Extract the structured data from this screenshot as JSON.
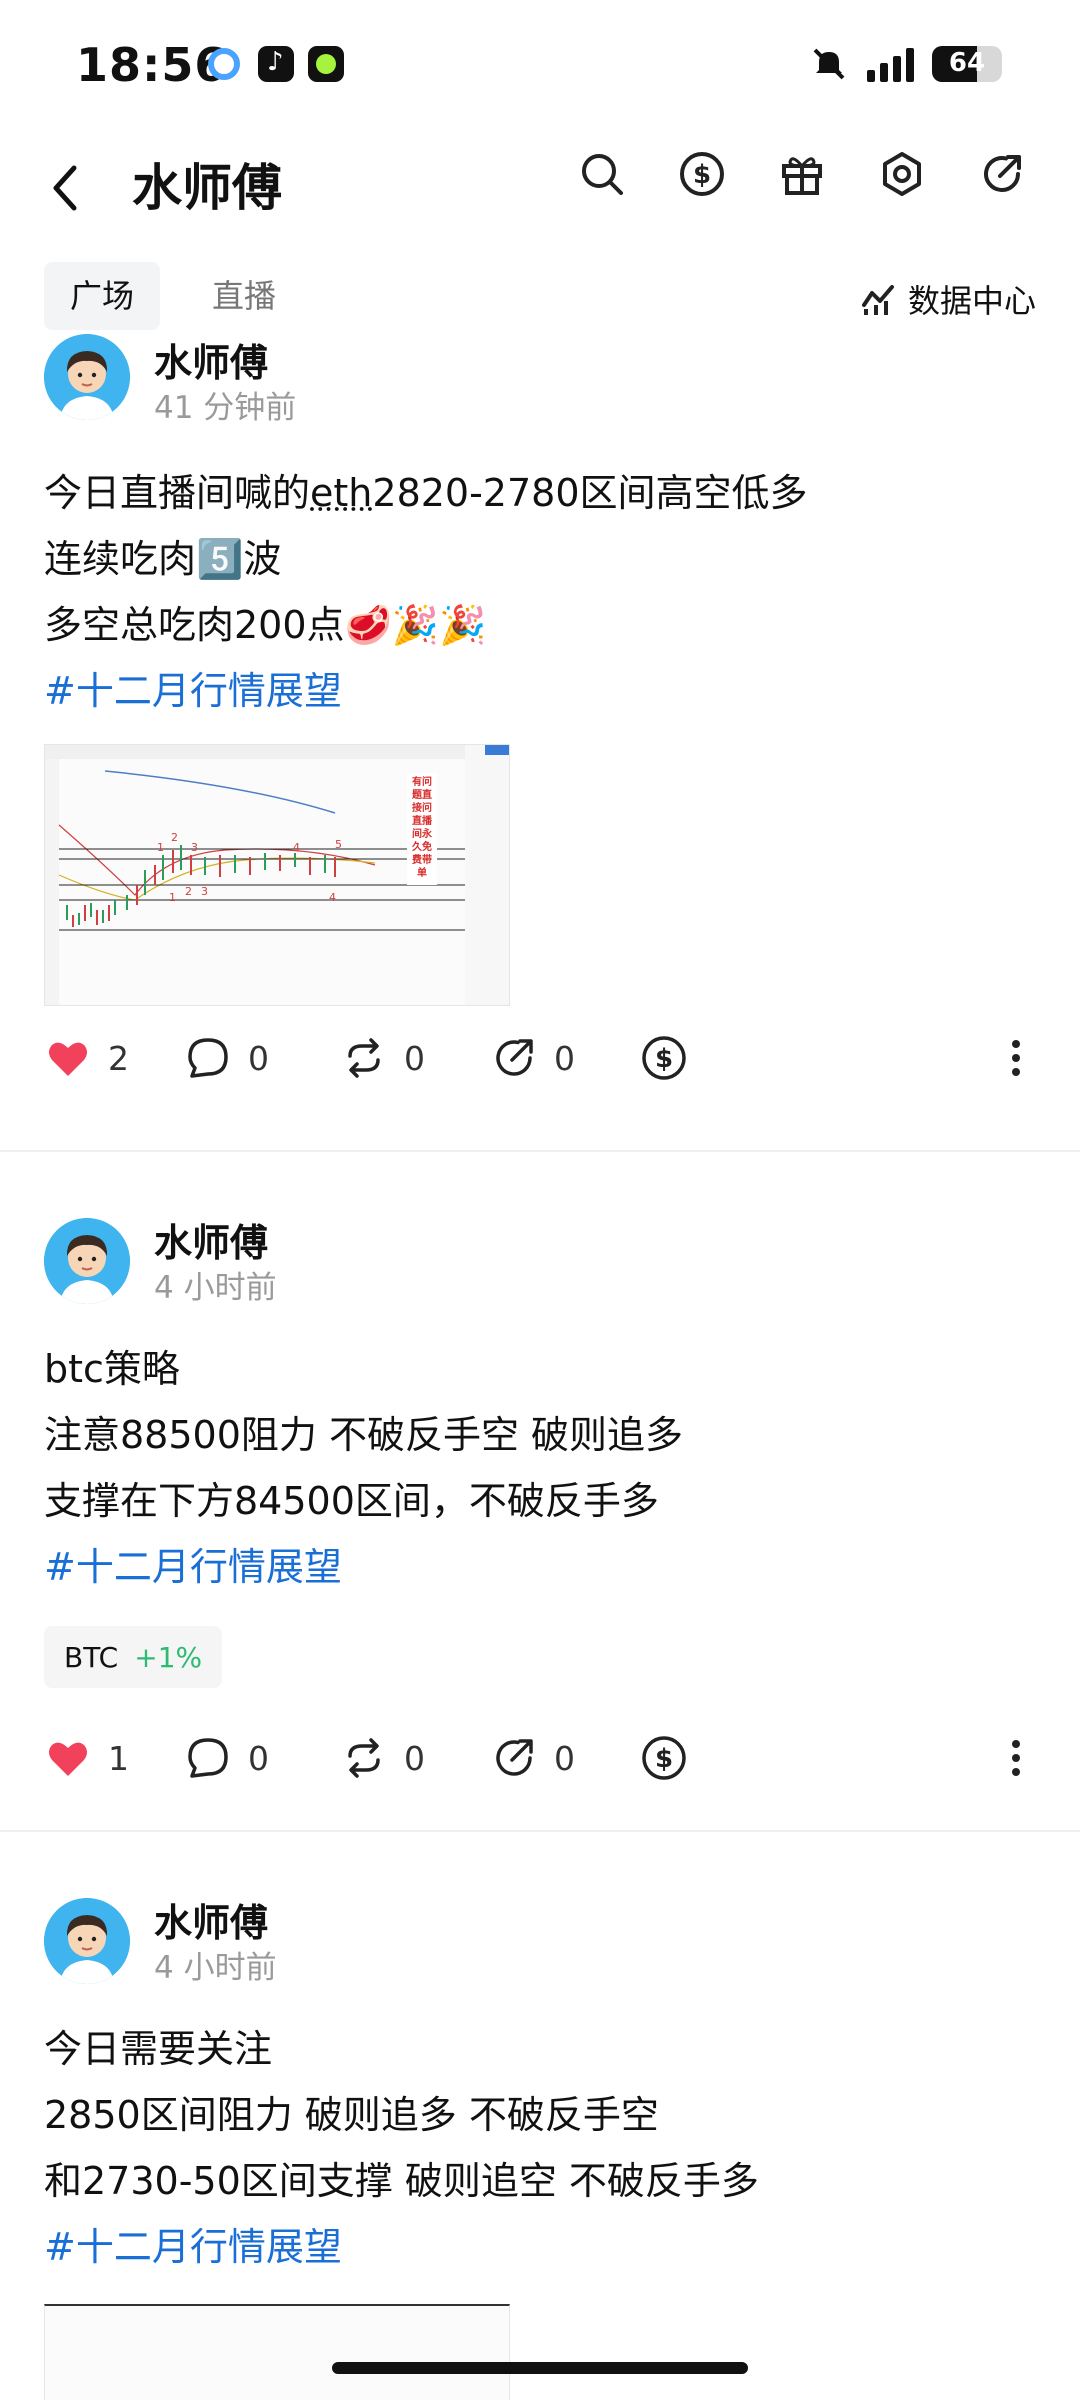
{
  "status_bar": {
    "time": "18:56",
    "battery": "64",
    "battery_level": 0.64
  },
  "nav": {
    "title": "水师傅",
    "back_icon": "chevron-left-icon",
    "icons": [
      "search-icon",
      "dollar-icon",
      "gift-icon",
      "settings-icon",
      "share-icon"
    ]
  },
  "tabs": {
    "items": [
      "广场",
      "直播"
    ],
    "active": "广场",
    "data_center": "数据中心"
  },
  "posts": [
    {
      "author": "水师傅",
      "time": "41 分钟前",
      "lines": [
        "今日直播间喊的",
        "eth",
        "2820-2780区间高空低多",
        "连续吃肉5️⃣波",
        "多空总吃肉200点🥩🎉🎉"
      ],
      "hashtag": "#十二月行情展望",
      "image_annotation": "有问题直接问直播间永久免费带单",
      "likes": "2",
      "comments": "0",
      "reposts": "0",
      "shares": "0"
    },
    {
      "author": "水师傅",
      "time": "4 小时前",
      "lines": [
        "btc策略",
        "注意88500阻力 不破反手空 破则追多",
        "支撑在下方84500区间，不破反手多"
      ],
      "hashtag": "#十二月行情展望",
      "coin": {
        "symbol": "BTC",
        "change": "+1%"
      },
      "likes": "1",
      "comments": "0",
      "reposts": "0",
      "shares": "0"
    },
    {
      "author": "水师傅",
      "time": "4 小时前",
      "lines": [
        "今日需要关注",
        "2850区间阻力 破则追多 不破反手空",
        "和2730-50区间支撑 破则追空 不破反手多"
      ],
      "hashtag": "#十二月行情展望"
    }
  ],
  "colors": {
    "accent": "#1a6fd6",
    "like": "#f2415b",
    "up": "#2dba73",
    "avatar_bg": "#3fb4ee"
  }
}
